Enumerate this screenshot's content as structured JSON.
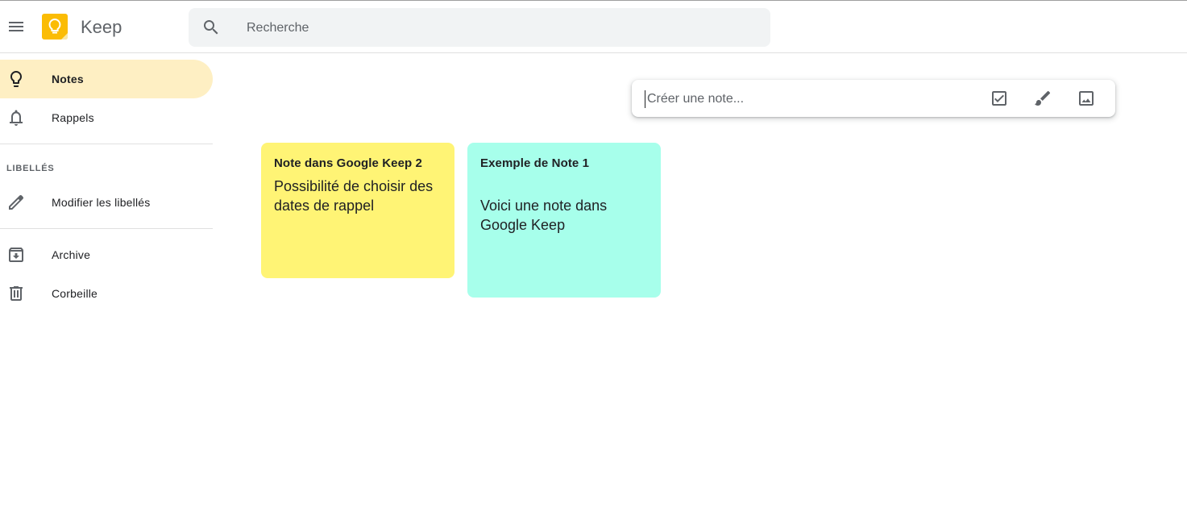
{
  "app": {
    "title": "Keep"
  },
  "search": {
    "placeholder": "Recherche"
  },
  "sidebar": {
    "items": [
      {
        "label": "Notes",
        "icon": "lightbulb-icon",
        "active": true
      },
      {
        "label": "Rappels",
        "icon": "bell-icon",
        "active": false
      }
    ],
    "labels_section_title": "LIBELLÉS",
    "edit_labels": "Modifier les libellés",
    "archive": "Archive",
    "trash": "Corbeille"
  },
  "composer": {
    "placeholder": "Créer une note...",
    "actions": [
      "checkbox-icon",
      "brush-icon",
      "image-icon"
    ]
  },
  "notes": [
    {
      "title": "Note dans Google Keep 2",
      "body": "Possibilité de choisir des dates de rappel",
      "color": "#fff475"
    },
    {
      "title": "Exemple de Note 1",
      "body": "Voici une note dans Google Keep",
      "color": "#a7ffeb"
    }
  ],
  "colors": {
    "accent": "#fbbc04",
    "active_nav": "#feefc3"
  }
}
